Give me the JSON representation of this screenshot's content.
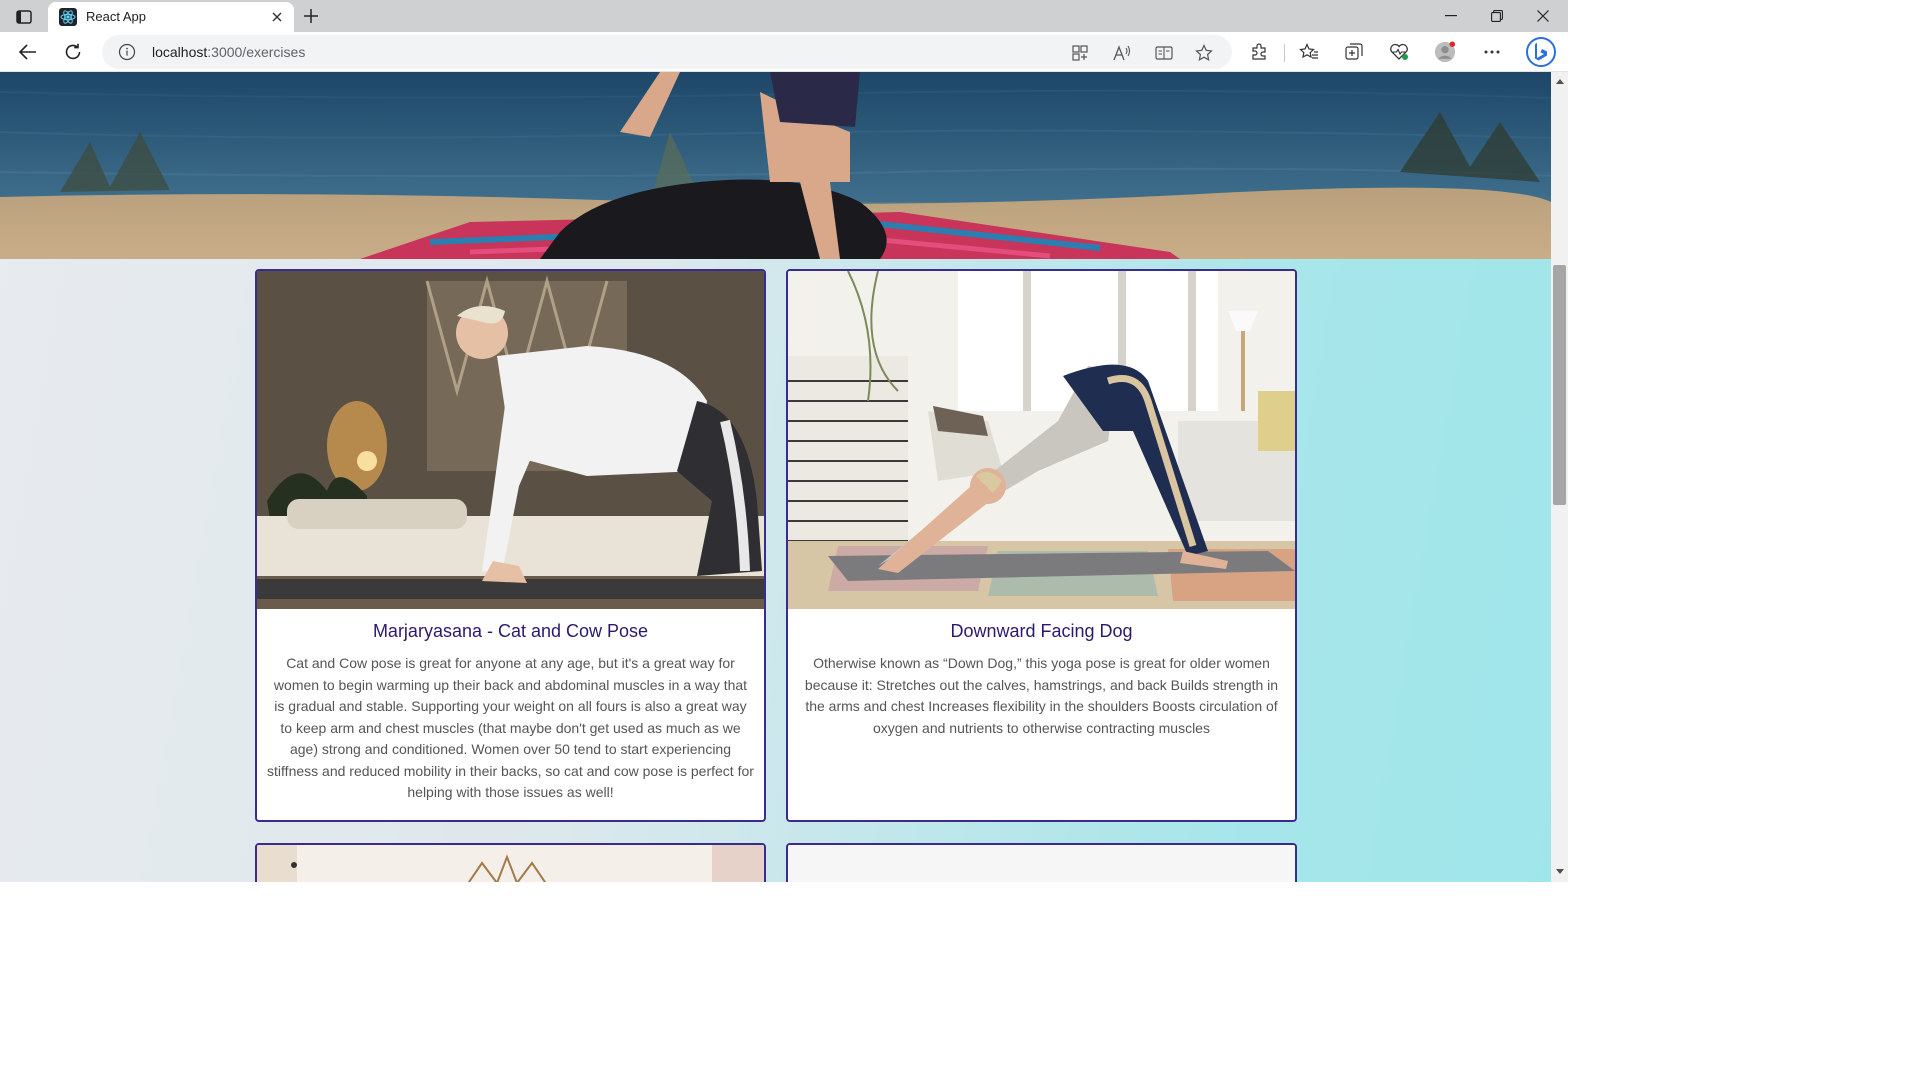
{
  "browser": {
    "tab_title": "React App",
    "url_host": "localhost",
    "url_path": ":3000/exercises",
    "icons": [
      "tab-actions-icon",
      "react-favicon-icon",
      "close-tab-icon",
      "new-tab-icon",
      "minimize-icon",
      "restore-icon",
      "close-window-icon",
      "back-icon",
      "refresh-icon",
      "site-info-icon",
      "app-available-icon",
      "read-aloud-icon",
      "immersive-reader-icon",
      "favorite-star-icon",
      "extensions-icon",
      "favorites-icon",
      "collections-icon",
      "browser-essentials-icon",
      "profile-icon",
      "more-icon",
      "bing-copilot-icon"
    ]
  },
  "cards": [
    {
      "title": "Marjaryasana - Cat and Cow Pose",
      "description": "Cat and Cow pose is great for anyone at any age, but it's a great way for women to begin warming up their back and abdominal muscles in a way that is gradual and stable. Supporting your weight on all fours is also a great way to keep arm and chest muscles (that maybe don't get used as much as we age) strong and conditioned. Women over 50 tend to start experiencing stiffness and reduced mobility in their backs, so cat and cow pose is perfect for helping with those issues as well!"
    },
    {
      "title": "Downward Facing Dog",
      "description": "Otherwise known as “Down Dog,” this yoga pose is great for older women because it: Stretches out the calves, hamstrings, and back Builds strength in the arms and chest Increases flexibility in the shoulders Boosts circulation of oxygen and nutrients to otherwise contracting muscles"
    }
  ],
  "colors": {
    "card_border": "#3b2b8c",
    "card_title": "#2a1a6e",
    "page_gradient_end": "#9fe6ea"
  }
}
